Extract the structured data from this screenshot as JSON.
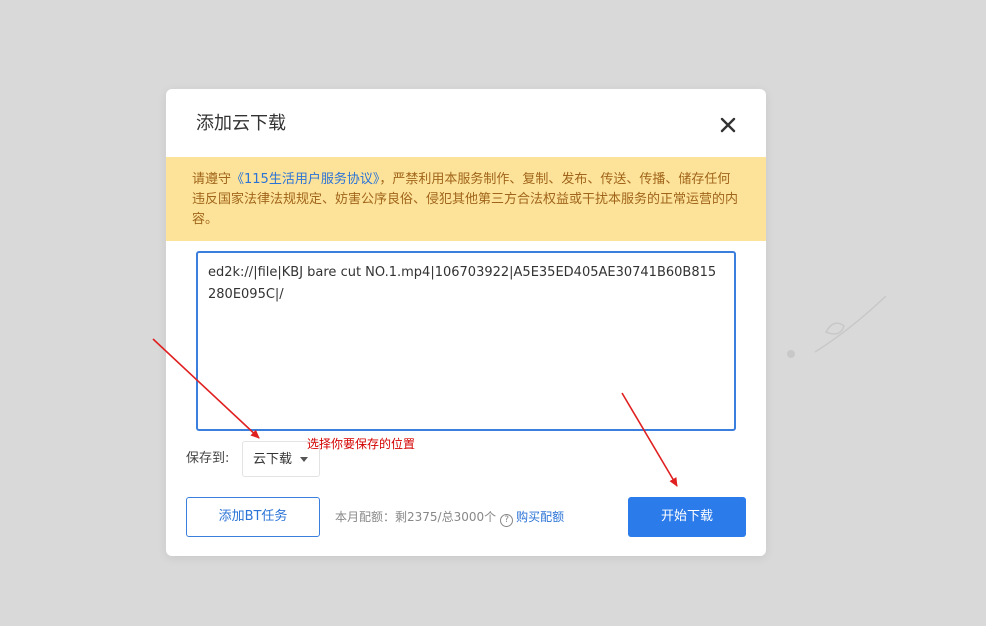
{
  "dialog": {
    "title": "添加云下载",
    "close_icon": "close-icon"
  },
  "notice": {
    "prefix": "请遵守",
    "link": "《115生活用户服务协议》",
    "suffix": "，严禁利用本服务制作、复制、发布、传送、传播、储存任何违反国家法律法规规定、妨害公序良俗、侵犯其他第三方合法权益或干扰本服务的正常运营的内容。"
  },
  "input": {
    "value": "ed2k://|file|KBJ bare cut NO.1.mp4|106703922|A5E35ED405AE30741B60B815280E095C|/"
  },
  "save": {
    "label": "保存到:",
    "selected": "云下载"
  },
  "annotation": {
    "text": "选择你要保存的位置"
  },
  "buttons": {
    "add_bt": "添加BT任务",
    "start": "开始下载"
  },
  "quota": {
    "text": "本月配额：剩2375/总3000个",
    "buy": "购买配额"
  },
  "colors": {
    "accent": "#2b7bea",
    "notice_bg": "#fde39a",
    "notice_text": "#a0651a",
    "annotation": "#d40000"
  }
}
